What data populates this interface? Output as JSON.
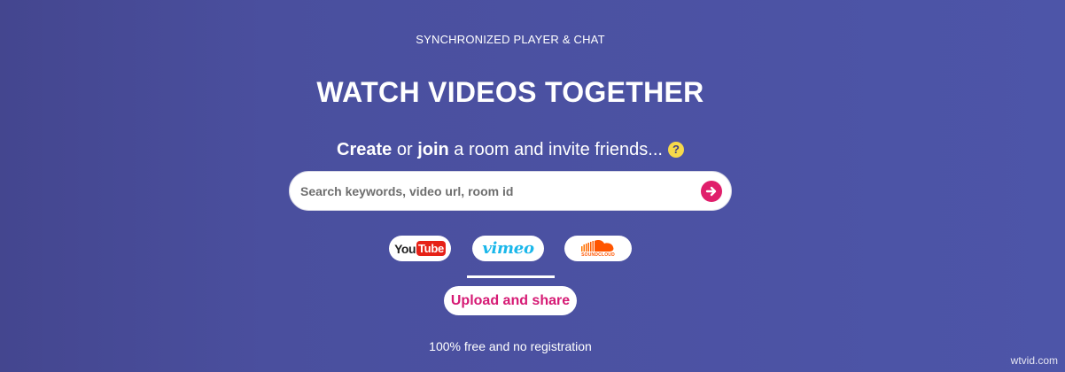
{
  "header": {
    "subtitle": "SYNCHRONIZED PLAYER & CHAT",
    "title": "WATCH VIDEOS TOGETHER"
  },
  "tagline": {
    "create": "Create",
    "or": " or ",
    "join": "join",
    "rest": " a room and invite friends...",
    "help_icon": "?"
  },
  "search": {
    "placeholder": "Search keywords, video url, room id",
    "submit_icon": "arrow-right-circle-icon"
  },
  "platforms": [
    {
      "name": "youtube",
      "label_you": "You",
      "label_tube": "Tube"
    },
    {
      "name": "vimeo",
      "label": "vimeo"
    },
    {
      "name": "soundcloud",
      "label": "SOUNDCLOUD"
    }
  ],
  "selected_platform": "vimeo",
  "upload": {
    "label": "Upload and share"
  },
  "footer": {
    "note": "100% free and no registration"
  },
  "watermark": "wtvid.com",
  "colors": {
    "background": "#4a4f9e",
    "accent": "#e01e6b",
    "upload_text": "#d61a74",
    "help_icon": "#f6d94a",
    "vimeo": "#1ab7ea",
    "youtube": "#e62117",
    "soundcloud": "#ff5500"
  }
}
